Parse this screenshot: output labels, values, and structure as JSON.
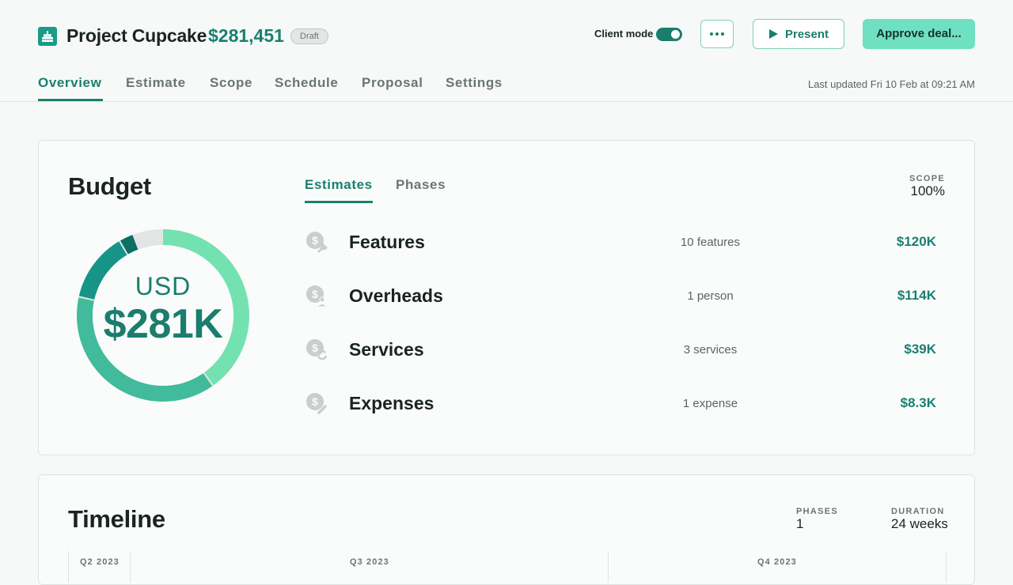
{
  "header": {
    "project_title": "Project Cupcake",
    "project_amount": "$281,451",
    "status_badge": "Draft",
    "client_mode_label": "Client mode",
    "client_mode_on": true,
    "present_label": "Present",
    "approve_label": "Approve deal...",
    "last_updated": "Last updated Fri 10 Feb at 09:21 AM"
  },
  "nav": {
    "tabs": [
      {
        "label": "Overview",
        "active": true
      },
      {
        "label": "Estimate",
        "active": false
      },
      {
        "label": "Scope",
        "active": false
      },
      {
        "label": "Schedule",
        "active": false
      },
      {
        "label": "Proposal",
        "active": false
      },
      {
        "label": "Settings",
        "active": false
      }
    ]
  },
  "budget": {
    "title": "Budget",
    "currency": "USD",
    "total": "$281K",
    "sub_tabs": [
      {
        "label": "Estimates",
        "active": true
      },
      {
        "label": "Phases",
        "active": false
      }
    ],
    "scope_label": "SCOPE",
    "scope_value": "100%",
    "rows": [
      {
        "name": "Features",
        "count": "10 features",
        "value": "$120K",
        "icon": "dollar-wrench-icon"
      },
      {
        "name": "Overheads",
        "count": "1 person",
        "value": "$114K",
        "icon": "dollar-person-icon"
      },
      {
        "name": "Services",
        "count": "3 services",
        "value": "$39K",
        "icon": "dollar-refresh-icon"
      },
      {
        "name": "Expenses",
        "count": "1 expense",
        "value": "$8.3K",
        "icon": "dollar-pencil-icon"
      }
    ],
    "donut_segments": [
      {
        "name": "Features",
        "amount": 120,
        "color": "#74e2b0"
      },
      {
        "name": "Overheads",
        "amount": 114,
        "color": "#41bb9b"
      },
      {
        "name": "Services",
        "amount": 39,
        "color": "#179488"
      },
      {
        "name": "Expenses",
        "amount": 8.3,
        "color": "#0d6e62"
      }
    ],
    "donut_remainder_color": "#e1e5e4"
  },
  "timeline": {
    "title": "Timeline",
    "phases_label": "PHASES",
    "phases_value": "1",
    "duration_label": "DURATION",
    "duration_value": "24 weeks",
    "quarters": [
      "Q2 2023",
      "Q3 2023",
      "Q4 2023"
    ]
  },
  "colors": {
    "accent": "#19806f",
    "accent_light": "#6fe0c2",
    "background": "#f6f9f8"
  }
}
